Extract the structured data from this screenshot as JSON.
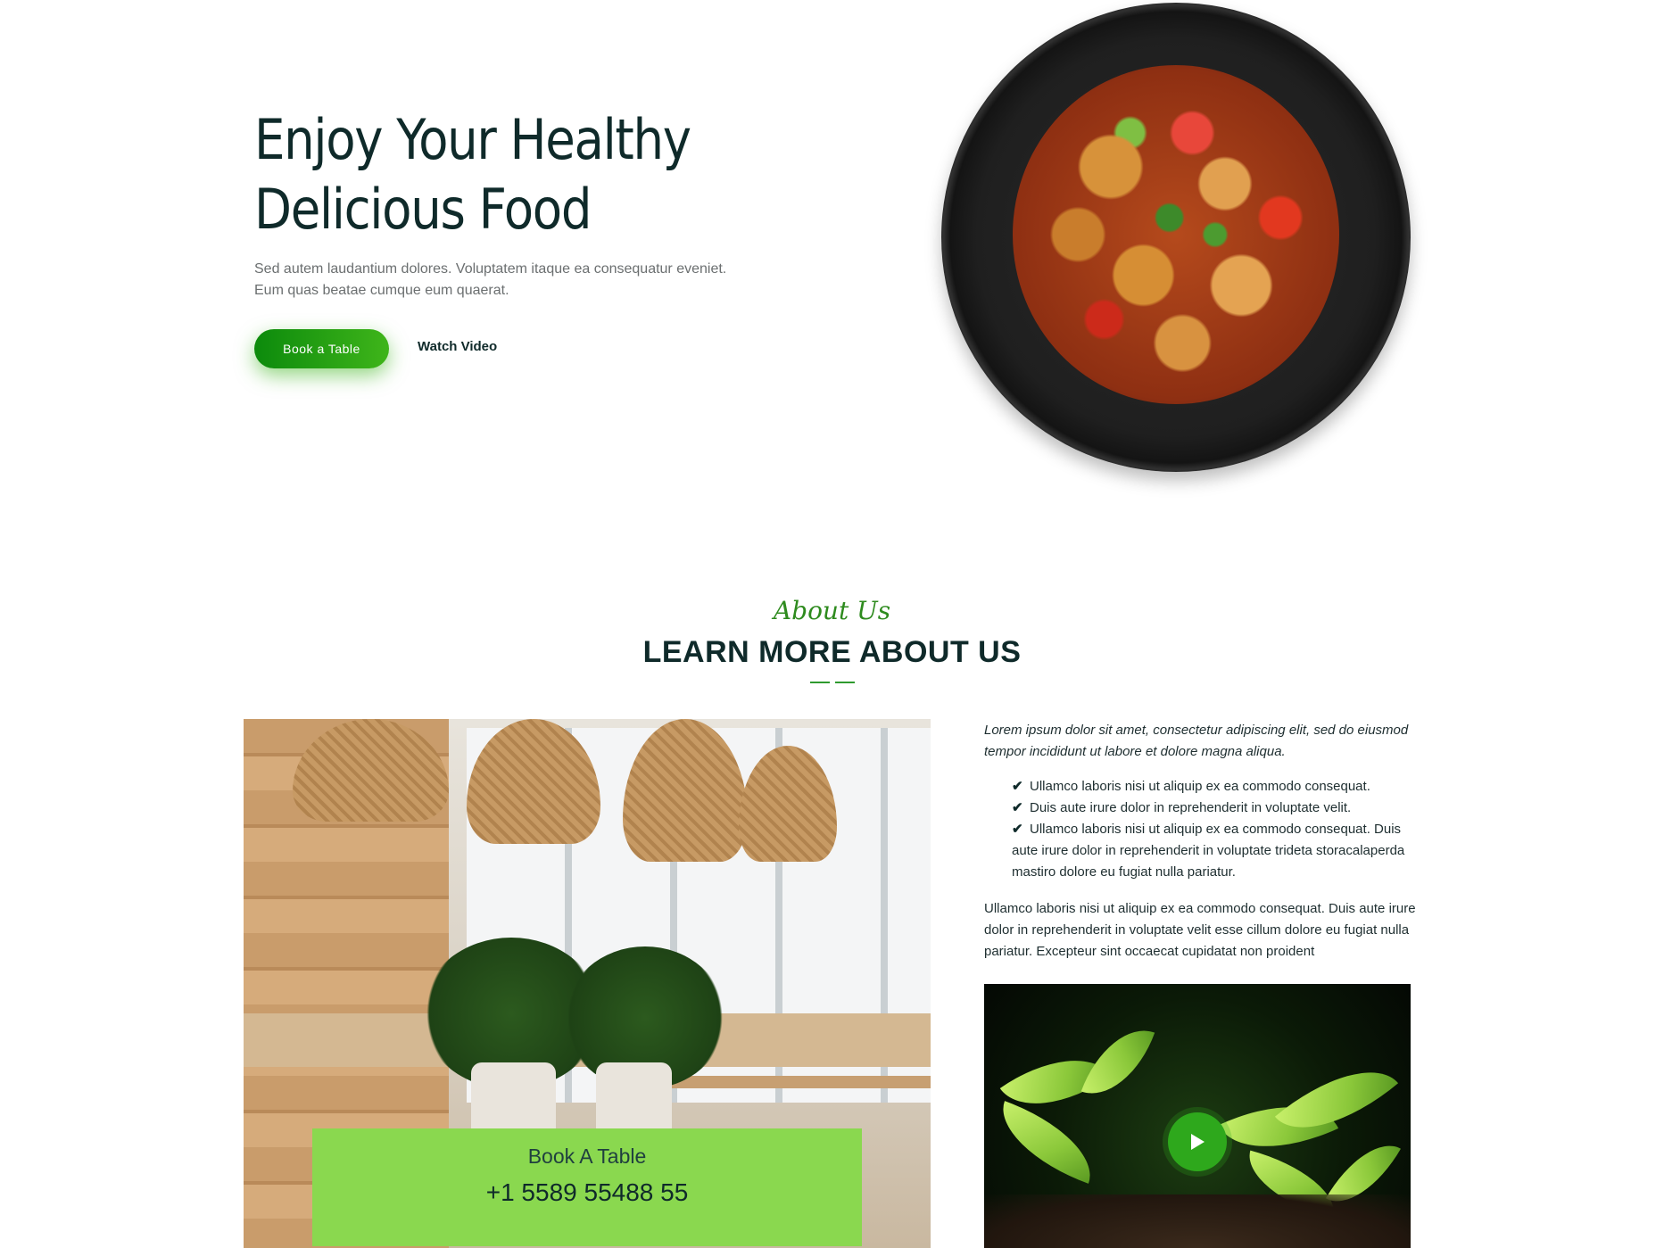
{
  "hero": {
    "title_line1": "Enjoy Your Healthy",
    "title_line2": "Delicious Food",
    "description": "Sed autem laudantium dolores. Voluptatem itaque ea consequatur eveniet. Eum quas beatae cumque eum quaerat.",
    "book_button": "Book a Table",
    "watch_video": "Watch Video"
  },
  "about": {
    "script_title": "About Us",
    "heading": "LEARN MORE ABOUT US",
    "book_card": {
      "title": "Book A Table",
      "phone": "+1 5589 55488 55"
    },
    "intro": "Lorem ipsum dolor sit amet, consectetur adipiscing elit, sed do eiusmod tempor incididunt ut labore et dolore magna aliqua.",
    "checklist": [
      "Ullamco laboris nisi ut aliquip ex ea commodo consequat.",
      "Duis aute irure dolor in reprehenderit in voluptate velit.",
      "Ullamco laboris nisi ut aliquip ex ea commodo consequat. Duis aute irure dolor in reprehenderit in voluptate trideta storacalaperda mastiro dolore eu fugiat nulla pariatur."
    ],
    "paragraph": "Ullamco laboris nisi ut aliquip ex ea commodo consequat. Duis aute irure dolor in reprehenderit in voluptate velit esse cillum dolore eu fugiat nulla pariatur. Excepteur sint occaecat cupidatat non proident"
  },
  "icons": {
    "check": "check-icon",
    "play": "play-icon"
  },
  "colors": {
    "accent_green": "#2ea81c",
    "card_green": "#8ad84f",
    "heading": "#0f2a2a"
  }
}
